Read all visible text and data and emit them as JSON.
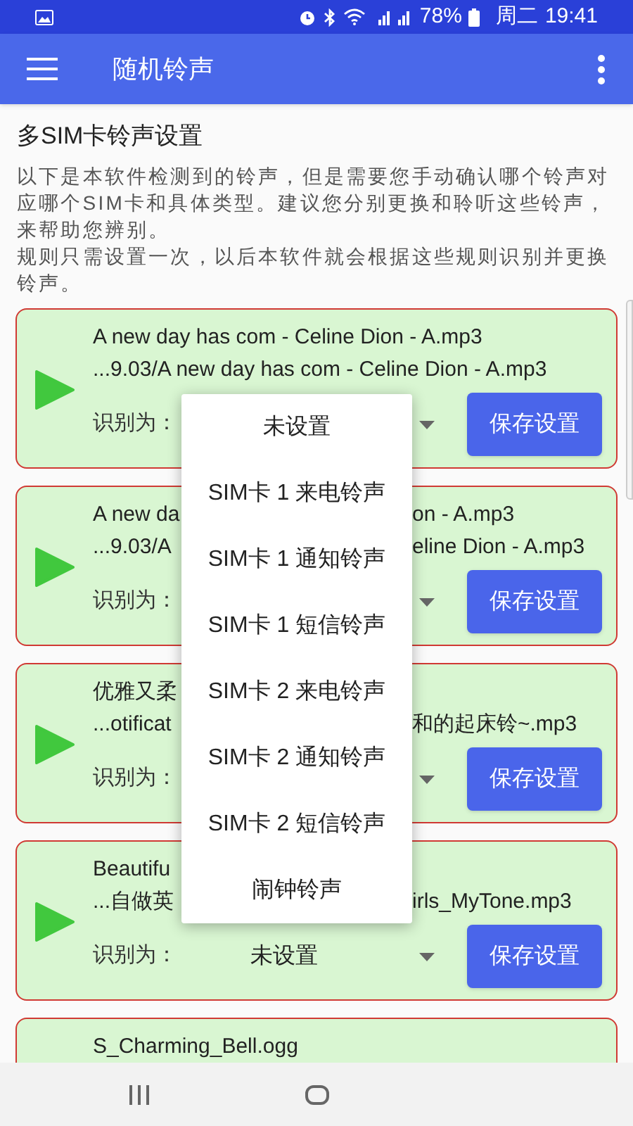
{
  "status_bar": {
    "battery": "78%",
    "day": "周二",
    "time": "19:41"
  },
  "app_bar": {
    "title": "随机铃声"
  },
  "heading": "多SIM卡铃声设置",
  "description": [
    "以下是本软件检测到的铃声，但是需要您手动确认哪个铃声对应哪个SIM卡和具体类型。建议您分别更换和聆听这些铃声，来帮助您辨别。",
    "规则只需设置一次，以后本软件就会根据这些规则识别并更换铃声。"
  ],
  "cards": [
    {
      "title": [
        "A new day has com - Celine Dion - A.mp3"
      ],
      "path": [
        "...9.03/A new day has com - Celine Dion - A.mp3"
      ],
      "label": "识别为：",
      "button": "保存设置"
    },
    {
      "title": [
        "A new da",
        "on - A.mp3"
      ],
      "path": [
        "...9.03/A",
        "eline Dion - A.mp3"
      ],
      "label": "识别为：",
      "button": "保存设置"
    },
    {
      "title": [
        "优雅又柔"
      ],
      "path": [
        "...otificat",
        "和的起床铃~.mp3"
      ],
      "label": "识别为：",
      "button": "保存设置"
    },
    {
      "title": [
        "Beautifu"
      ],
      "path": [
        "...自做英",
        "irls_MyTone.mp3"
      ],
      "label": "识别为：",
      "select": {
        "value": "未设置"
      },
      "button": "保存设置"
    },
    {
      "title": [
        "S_Charming_Bell.ogg"
      ]
    }
  ],
  "menu": [
    "未设置",
    "SIM卡 1 来电铃声",
    "SIM卡 1 通知铃声",
    "SIM卡 1 短信铃声",
    "SIM卡 2 来电铃声",
    "SIM卡 2 通知铃声",
    "SIM卡 2 短信铃声",
    "闹钟铃声"
  ]
}
